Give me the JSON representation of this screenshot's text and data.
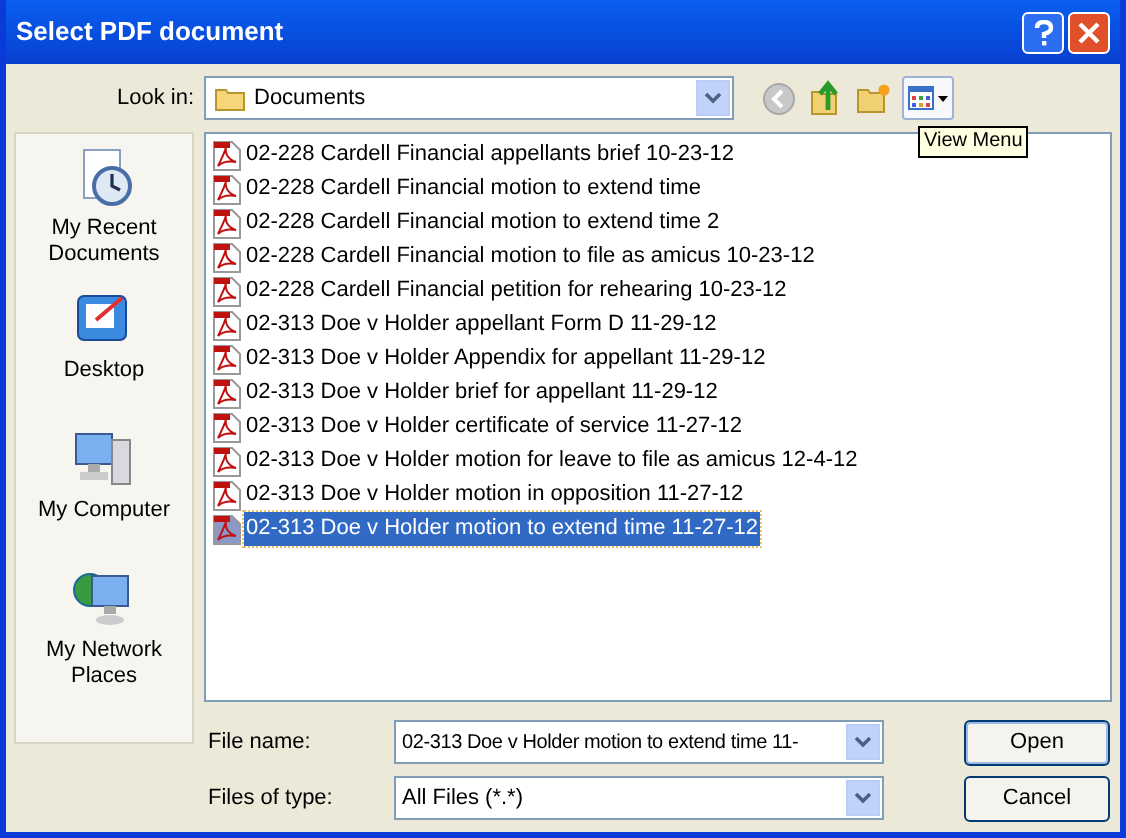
{
  "window": {
    "title": "Select PDF document"
  },
  "look_in": {
    "label": "Look in:",
    "value": "Documents"
  },
  "tooltip": "View Menu",
  "places": [
    {
      "label": "My Recent Documents",
      "kind": "recent"
    },
    {
      "label": "Desktop",
      "kind": "desktop"
    },
    {
      "label": "My Computer",
      "kind": "computer"
    },
    {
      "label": "My Network Places",
      "kind": "network"
    }
  ],
  "files": [
    {
      "name": "02-228 Cardell Financial appellants brief 10-23-12",
      "selected": false
    },
    {
      "name": "02-228 Cardell Financial motion to extend time",
      "selected": false
    },
    {
      "name": "02-228 Cardell Financial motion to extend time 2",
      "selected": false
    },
    {
      "name": "02-228 Cardell Financial motion to file as amicus 10-23-12",
      "selected": false
    },
    {
      "name": "02-228 Cardell Financial petition for rehearing 10-23-12",
      "selected": false
    },
    {
      "name": "02-313 Doe v Holder appellant Form D 11-29-12",
      "selected": false
    },
    {
      "name": "02-313 Doe v Holder Appendix for appellant 11-29-12",
      "selected": false
    },
    {
      "name": "02-313 Doe v Holder brief for appellant 11-29-12",
      "selected": false
    },
    {
      "name": "02-313 Doe v Holder certificate of service 11-27-12",
      "selected": false
    },
    {
      "name": "02-313 Doe v Holder motion for leave to file as amicus 12-4-12",
      "selected": false
    },
    {
      "name": "02-313 Doe v Holder motion in opposition 11-27-12",
      "selected": false
    },
    {
      "name": "02-313 Doe v Holder motion to extend time 11-27-12",
      "selected": true
    }
  ],
  "file_name": {
    "label": "File name:",
    "value": "02-313 Doe v Holder motion to extend time 11-"
  },
  "file_type": {
    "label": "Files of type:",
    "value": "All Files (*.*)"
  },
  "buttons": [
    "Open",
    "Cancel"
  ]
}
